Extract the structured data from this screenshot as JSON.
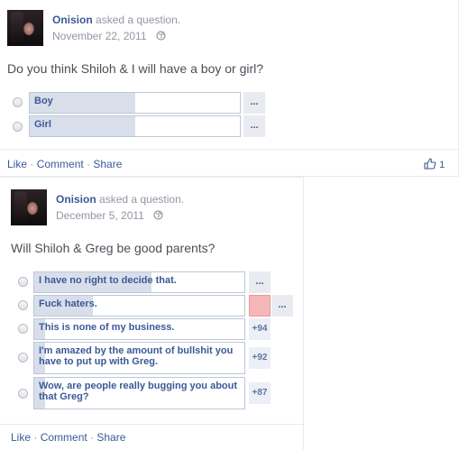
{
  "post1": {
    "author": "Onision",
    "action": "asked a question.",
    "date": "November 22, 2011",
    "question": "Do you think Shiloh & I will have a boy or girl?",
    "options": [
      {
        "label": "Boy",
        "fill_fraction": 0.5,
        "more": "..."
      },
      {
        "label": "Girl",
        "fill_fraction": 0.5,
        "more": "..."
      }
    ],
    "footer": {
      "like": "Like",
      "comment": "Comment",
      "share": "Share",
      "sep": " · "
    },
    "like_count": "1"
  },
  "post2": {
    "author": "Onision",
    "action": "asked a question.",
    "date": "December 5, 2011",
    "question": "Will Shiloh & Greg be good parents?",
    "options": [
      {
        "label": "I have no right to decide that.",
        "fill_fraction": 0.56,
        "side": "..."
      },
      {
        "label": "Fuck haters.",
        "fill_fraction": 0.28,
        "side": "..."
      },
      {
        "label": "This is none of my business.",
        "fill_fraction": 0.05,
        "side": "+94"
      },
      {
        "label": "I'm amazed by the amount of bullshit you have to put up with Greg.",
        "fill_fraction": 0.05,
        "side": "+92"
      },
      {
        "label": "Wow, are people really bugging you about that Greg?",
        "fill_fraction": 0.05,
        "side": "+87"
      }
    ],
    "footer": {
      "like": "Like",
      "comment": "Comment",
      "share": "Share",
      "sep": " · "
    }
  },
  "colors": {
    "link": "#3b5998",
    "muted": "#9197a3",
    "bar_fill": "#d8dfea",
    "voter_avatar": "#f4b6b6"
  }
}
